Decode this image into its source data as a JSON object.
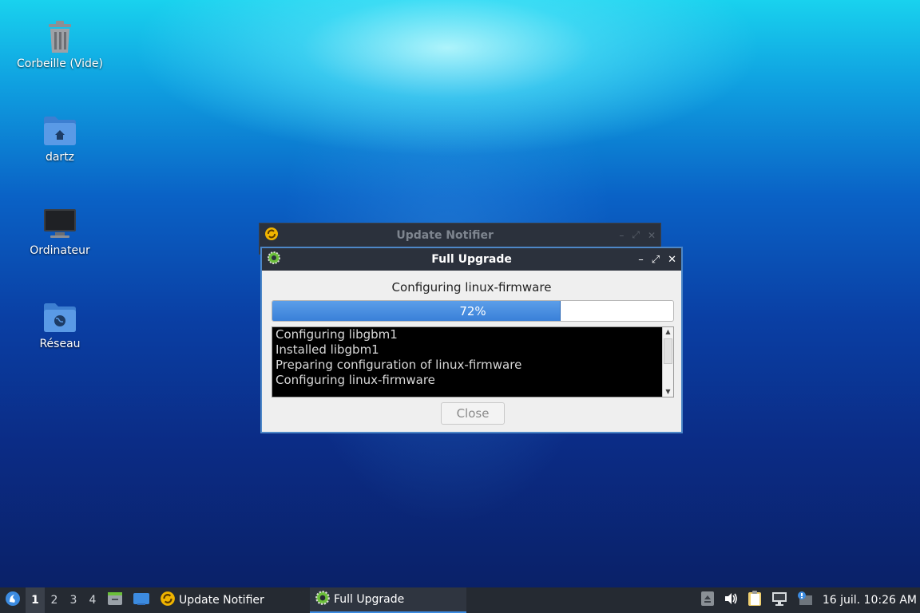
{
  "desktop": {
    "icons": [
      {
        "label": "Corbeille (Vide)",
        "icon": "trash-icon"
      },
      {
        "label": "dartz",
        "icon": "home-folder-icon"
      },
      {
        "label": "Ordinateur",
        "icon": "computer-icon"
      },
      {
        "label": "Réseau",
        "icon": "network-folder-icon"
      }
    ]
  },
  "background_window": {
    "title": "Update Notifier",
    "icon": "update-notifier-icon"
  },
  "dialog": {
    "title": "Full Upgrade",
    "icon": "gear-icon",
    "controls": {
      "minimize": "–",
      "maximize": "⤢",
      "close": "✕"
    },
    "status": "Configuring linux-firmware",
    "progress": {
      "value": 0.72,
      "label": "72%"
    },
    "log_lines": [
      "Configuring libgbm1",
      "Installed libgbm1",
      "Preparing configuration of linux-firmware",
      "Configuring linux-firmware"
    ],
    "close_button": "Close"
  },
  "taskbar": {
    "menu_icon": "start-menu-icon",
    "workspaces": [
      "1",
      "2",
      "3",
      "4"
    ],
    "active_workspace": "1",
    "quicklaunch": [
      "file-manager-icon",
      "show-desktop-icon"
    ],
    "tasks": [
      {
        "label": "Update Notifier",
        "icon": "update-notifier-icon",
        "active": false
      },
      {
        "label": "Full Upgrade",
        "icon": "gear-icon",
        "active": true
      }
    ],
    "tray": [
      "eject-icon",
      "volume-icon",
      "clipboard-icon",
      "network-icon",
      "update-alert-icon"
    ],
    "clock": "16 juil. 10:26 AM"
  },
  "colors": {
    "accent": "#3c8be0",
    "titlebar": "#2b313c",
    "progress_fill": "#4a8fe0"
  }
}
